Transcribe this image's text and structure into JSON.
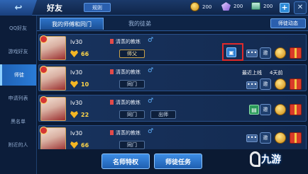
{
  "header": {
    "back_label": "↩",
    "title": "好友",
    "rules_label": "规则",
    "coins": "200",
    "gems": "200",
    "vouchers": "200",
    "plus_label": "+",
    "close_label": "✕"
  },
  "sidebar": {
    "items": [
      {
        "label": "QQ好友",
        "active": false
      },
      {
        "label": "游戏好友",
        "active": false
      },
      {
        "label": "师徒",
        "active": true
      },
      {
        "label": "申请列表",
        "active": false
      },
      {
        "label": "黑名单",
        "active": false
      },
      {
        "label": "附近的人",
        "active": false
      }
    ]
  },
  "tabs": [
    {
      "label": "我的师傅和同门",
      "active": true
    },
    {
      "label": "我的徒弟",
      "active": false
    }
  ],
  "updates_label": "师徒动态",
  "rows": [
    {
      "level": "lv30",
      "intimacy": "66",
      "name": "清蒸的教练",
      "tags": [
        "师父"
      ],
      "status_label": "",
      "status_days": ""
    },
    {
      "level": "lv30",
      "intimacy": "10",
      "name": "清蒸的教练",
      "tags": [
        "同门"
      ],
      "status_label": "最近上线",
      "status_days": "4天前"
    },
    {
      "level": "lv30",
      "intimacy": "22",
      "name": "清蒸的教练",
      "tags": [
        "同门",
        "出师"
      ],
      "status_label": "",
      "status_days": ""
    },
    {
      "level": "lv30",
      "intimacy": "66",
      "name": "清蒸的教练",
      "tags": [
        "同门"
      ],
      "status_label": "",
      "status_days": ""
    }
  ],
  "actions": {
    "more_label": "•••",
    "invite_label": "邀"
  },
  "bottom": {
    "privileges_label": "名师特权",
    "tasks_label": "师徒任务"
  },
  "watermark": "九游"
}
